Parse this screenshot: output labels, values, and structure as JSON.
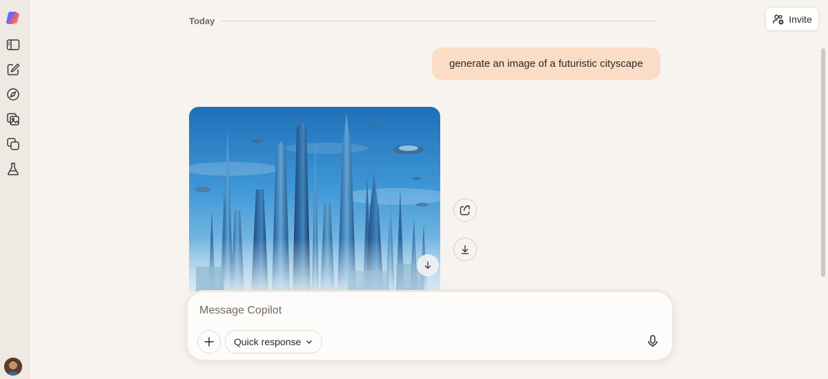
{
  "sidebar": {
    "icons": [
      "copilot-logo",
      "sidebar-toggle-icon",
      "new-chat-icon",
      "discover-icon",
      "image-gallery-icon",
      "pages-icon",
      "labs-icon"
    ]
  },
  "header": {
    "date_divider": "Today",
    "invite_label": "Invite"
  },
  "conversation": {
    "user_message": "generate an image of a futuristic cityscape"
  },
  "composer": {
    "placeholder": "Message Copilot",
    "mode_label": "Quick response"
  },
  "colors": {
    "background": "#f7f3ef",
    "user_bubble": "#fbdcc6",
    "sidebar": "#efe9e3"
  }
}
